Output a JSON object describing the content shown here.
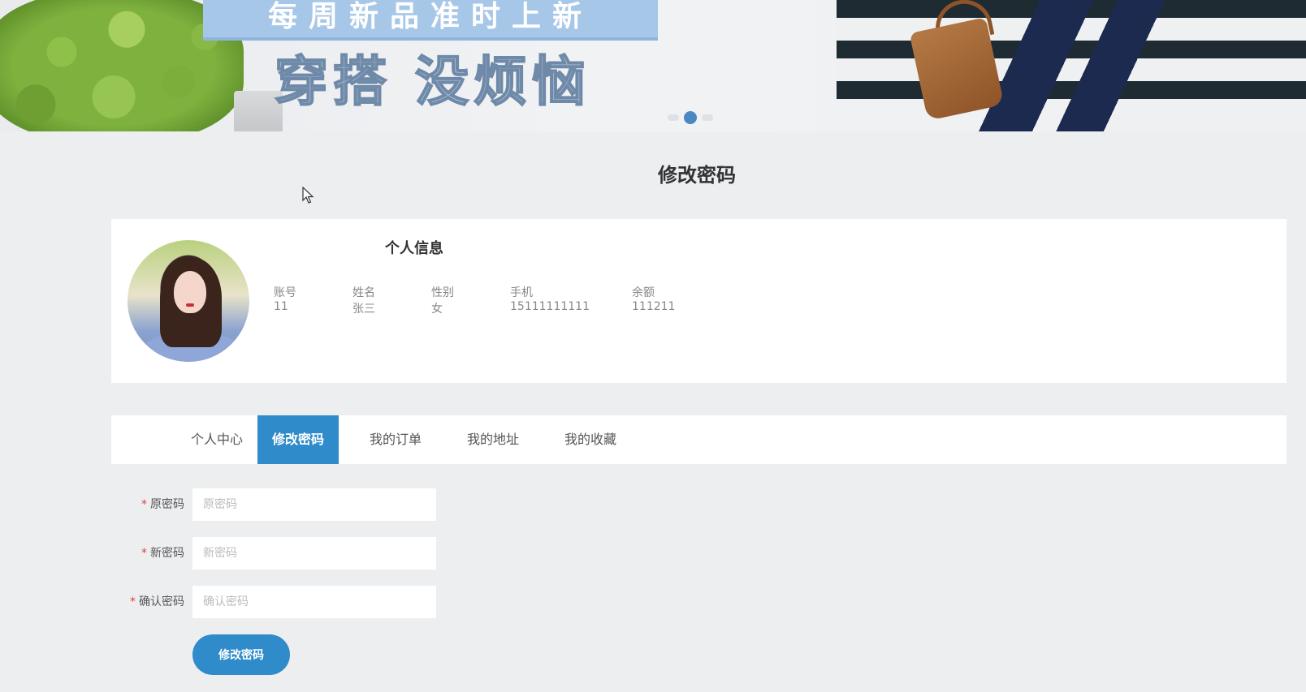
{
  "banner": {
    "headline": "每周新品准时上新",
    "slogan": "穿搭 没烦恼",
    "slide_count": 3,
    "active_slide": 2
  },
  "page_title": "修改密码",
  "profile": {
    "title": "个人信息",
    "fields": [
      {
        "label": "账号",
        "value": "11"
      },
      {
        "label": "姓名",
        "value": "张三"
      },
      {
        "label": "性别",
        "value": "女"
      },
      {
        "label": "手机",
        "value": "15111111111"
      },
      {
        "label": "余额",
        "value": "111211"
      }
    ]
  },
  "tabs": [
    {
      "label": "个人中心"
    },
    {
      "label": "修改密码",
      "active": true
    },
    {
      "label": "我的订单"
    },
    {
      "label": "我的地址"
    },
    {
      "label": "我的收藏"
    }
  ],
  "form": {
    "required_mark": "*",
    "old_password": {
      "label": "原密码",
      "placeholder": "原密码",
      "value": ""
    },
    "new_password": {
      "label": "新密码",
      "placeholder": "新密码",
      "value": ""
    },
    "confirm_password": {
      "label": "确认密码",
      "placeholder": "确认密码",
      "value": ""
    },
    "submit_label": "修改密码"
  },
  "colors": {
    "accent": "#2f8bc9",
    "required": "#e0403a",
    "background": "#edeef0"
  }
}
